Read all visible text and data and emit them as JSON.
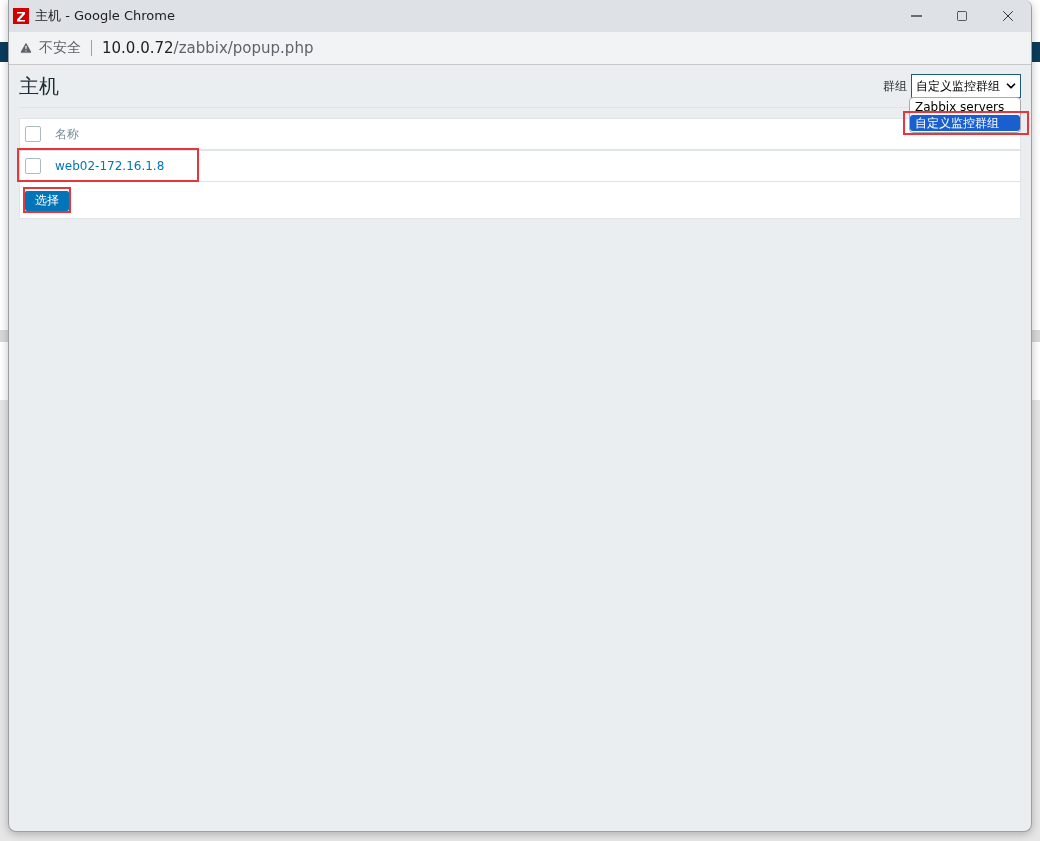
{
  "window": {
    "title": "主机 - Google Chrome"
  },
  "address_bar": {
    "security": "不安全",
    "url_host": "10.0.0.72",
    "url_path": "/zabbix/popup.php"
  },
  "page": {
    "title": "主机",
    "group_filter": {
      "label": "群组",
      "value": "自定义监控群组",
      "expanded": true,
      "highlighted": true,
      "options": [
        {
          "label": "Zabbix servers",
          "selected": false
        },
        {
          "label": "自定义监控群组",
          "selected": true
        }
      ]
    }
  },
  "table": {
    "header": {
      "label": "名称",
      "checked": false
    },
    "rows": [
      {
        "name": "web02-172.16.1.8",
        "checked": false,
        "highlighted": true
      }
    ]
  },
  "buttons": [
    {
      "label": "选择",
      "highlighted": true
    }
  ]
}
